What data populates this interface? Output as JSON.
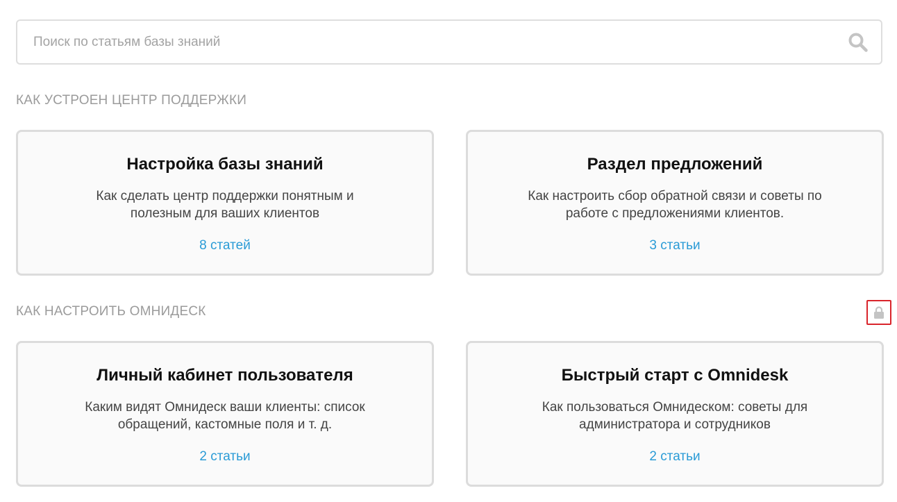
{
  "search": {
    "placeholder": "Поиск по статьям базы знаний",
    "value": "",
    "button_icon": "search-icon"
  },
  "sections": [
    {
      "title": "КАК УСТРОЕН ЦЕНТР ПОДДЕРЖКИ",
      "cards": [
        {
          "title": "Настройка базы знаний",
          "description_lines": [
            "Как сделать центр поддержки понятным и",
            "полезным для ваших клиентов"
          ],
          "count": "8 статей"
        },
        {
          "title": "Раздел предложений",
          "description_lines": [
            "Как настроить сбор обратной связи и советы по",
            "работе с предложениями клиентов."
          ],
          "count": "3 статьи"
        }
      ]
    },
    {
      "title": "КАК НАСТРОИТЬ ОМНИДЕСК",
      "action_icon": "lock-icon",
      "cards": [
        {
          "title": "Личный кабинет пользователя",
          "description_lines": [
            "Каким видят Омнидеск ваши клиенты: список",
            "обращений, кастомные поля и т. д."
          ],
          "count": "2 статьи"
        },
        {
          "title": "Быстрый старт с Omnidesk",
          "description_lines": [
            "Как пользоваться Омнидеском: советы для",
            "администратора и сотрудников"
          ],
          "count": "2 статьи"
        }
      ]
    }
  ],
  "colors": {
    "link": "#2a9bd6",
    "section_title": "#9b9b9b",
    "card_border": "#dcdcdc",
    "card_background": "#fafafa",
    "highlight": "#d9242b",
    "icon_gray": "#c4c4c4"
  }
}
